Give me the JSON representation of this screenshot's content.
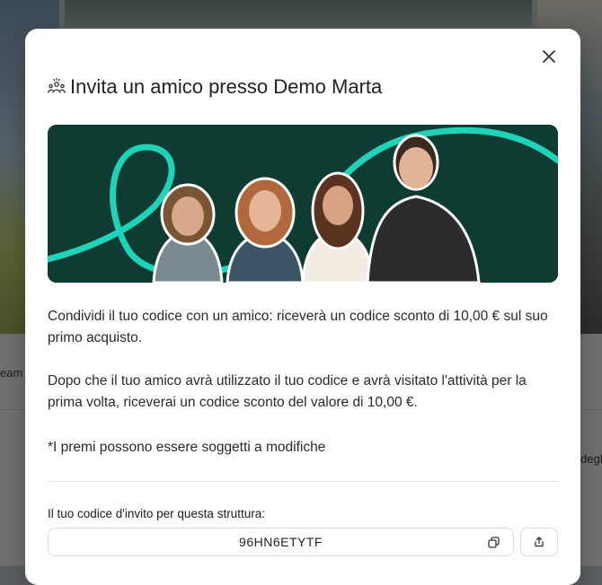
{
  "background": {
    "left_text": "eam",
    "right_text": "degl"
  },
  "modal": {
    "title": "Invita un amico presso Demo Marta",
    "title_icon": "people-group-icon",
    "close_icon": "close-icon",
    "description_1": "Condividi il tuo codice con un amico: riceverà un codice sconto di 10,00 € sul suo primo acquisto.",
    "description_2": "Dopo che il tuo amico avrà utilizzato il tuo codice e avrà visitato l'attività per la prima volta, riceverai un codice sconto del valore di 10,00 €.",
    "disclaimer": "*I premi possono essere soggetti a modifiche",
    "code_label": "Il tuo codice d'invito per questa struttura:",
    "invite_code": "96HN6ETYTF",
    "copy_icon": "copy-icon",
    "share_icon": "share-icon",
    "banner_colors": {
      "background": "#0e3b32",
      "accent": "#1ed3b8"
    }
  }
}
